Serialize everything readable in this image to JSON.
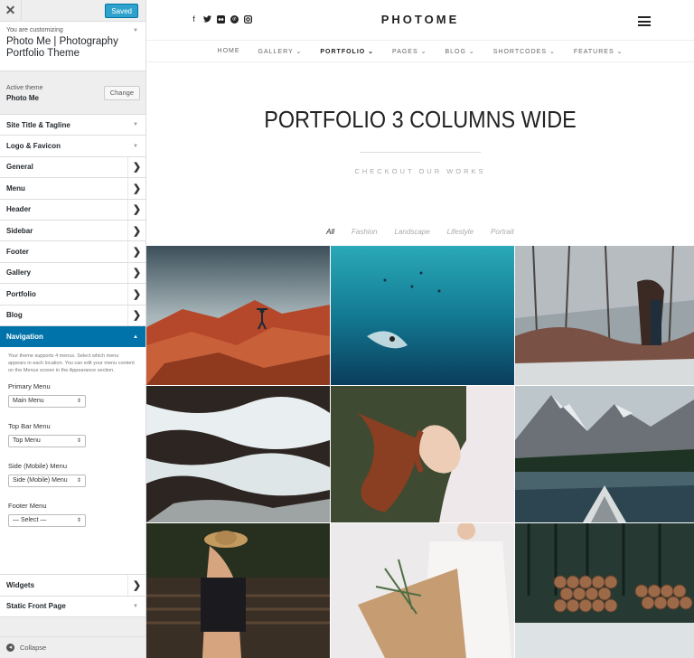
{
  "customizer": {
    "close_glyph": "✕",
    "saved_label": "Saved",
    "customizing_label": "You are customizing",
    "site_title": "Photo Me | Photography Portfolio Theme",
    "active_theme_label": "Active theme",
    "active_theme_name": "Photo Me",
    "change_label": "Change",
    "sections": [
      {
        "label": "Site Title & Tagline"
      },
      {
        "label": "Logo & Favicon"
      },
      {
        "label": "General"
      },
      {
        "label": "Menu"
      },
      {
        "label": "Header"
      },
      {
        "label": "Sidebar"
      },
      {
        "label": "Footer"
      },
      {
        "label": "Gallery"
      },
      {
        "label": "Portfolio"
      },
      {
        "label": "Blog"
      },
      {
        "label": "Navigation"
      }
    ],
    "navigation": {
      "description": "Your theme supports 4 menus. Select which menu appears in each location. You can edit your menu content on the Menus screen in the Appearance section.",
      "locations": [
        {
          "label": "Primary Menu",
          "value": "Main Menu"
        },
        {
          "label": "Top Bar Menu",
          "value": "Top Menu"
        },
        {
          "label": "Side (Mobile) Menu",
          "value": "Side (Mobile) Menu"
        },
        {
          "label": "Footer Menu",
          "value": "— Select —"
        }
      ]
    },
    "after_sections": [
      {
        "label": "Widgets"
      },
      {
        "label": "Static Front Page"
      }
    ],
    "collapse_label": "Collapse"
  },
  "site": {
    "logo": "PHOTOME",
    "menu": [
      "HOME",
      "GALLERY ⌄",
      "PORTFOLIO ⌄",
      "PAGES ⌄",
      "BLOG ⌄",
      "SHORTCODES ⌄",
      "FEATURES ⌄"
    ],
    "page_title": "PORTFOLIO 3 COLUMNS WIDE",
    "subtitle": "CHECKOUT OUR WORKS",
    "filters": [
      "All",
      "Fashion",
      "Landscape",
      "Lifestyle",
      "Portrait"
    ]
  },
  "colors": {
    "accent": "#0073aa",
    "saved_button": "#2ea2cc"
  }
}
